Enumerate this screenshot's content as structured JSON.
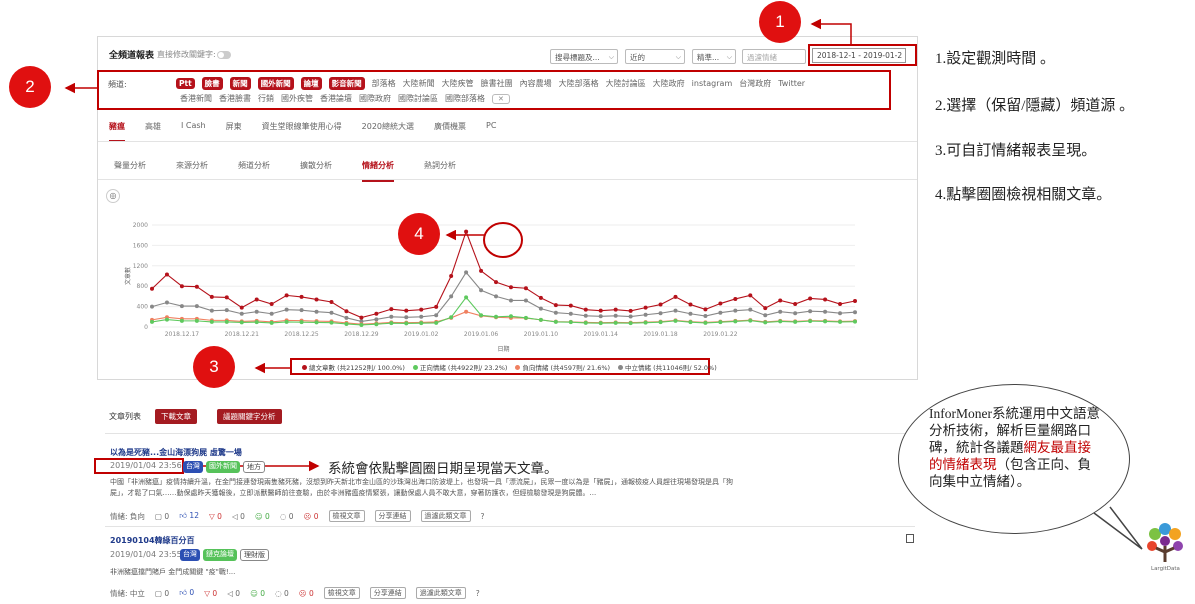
{
  "report": {
    "title": "全頻道報表",
    "sub": "直接修改關鍵字:",
    "selects": [
      "搜尋標題及...",
      "近的",
      "精準...",
      "過濾情緒"
    ],
    "date": "2018-12-1 - 2019-01-2",
    "channel_label": "頻道:",
    "channels_selected": [
      "Ptt",
      "臉書",
      "新聞",
      "國外新聞",
      "論壇",
      "影音新聞"
    ],
    "channels_row1": [
      "部落格",
      "大陸新聞",
      "大陸疾管",
      "臉書社團",
      "內容農場",
      "大陸部落格",
      "大陸討論區",
      "大陸政府",
      "instagram",
      "台灣政府",
      "Twitter"
    ],
    "channels_row2": [
      "香港新聞",
      "香港臉書",
      "行銷",
      "國外疾管",
      "香港論壇",
      "國際政府",
      "國際討論區",
      "國際部落格"
    ],
    "clear": "✕",
    "topic_tabs": [
      "豬瘟",
      "高雄",
      "I Cash",
      "屏東",
      "資生堂眼線筆使用心得",
      "2020總統大選",
      "廣價機票",
      "PC"
    ],
    "analysis_tabs": [
      "聲量分析",
      "來源分析",
      "頻道分析",
      "擴散分析",
      "情緒分析",
      "熱詞分析"
    ],
    "camera": "◎"
  },
  "chart_data": {
    "type": "line",
    "xlabel": "日期",
    "ylabel": "文章數",
    "ylim": [
      0,
      2000
    ],
    "yticks": [
      "0",
      "400",
      "800",
      "1200",
      "1600",
      "2000"
    ],
    "xticks": [
      "2018.12.17",
      "2018.12.21",
      "2018.12.25",
      "2018.12.29",
      "2019.01.02",
      "2019.01.06",
      "2019.01.10",
      "2019.01.14",
      "2019.01.18",
      "2019.01.22"
    ],
    "series": [
      {
        "name": "總文章數 (共21252則/ 100.0%)",
        "color": "#b5121b",
        "values": [
          750,
          1030,
          800,
          790,
          590,
          580,
          380,
          540,
          450,
          620,
          590,
          540,
          490,
          310,
          185,
          260,
          350,
          320,
          340,
          395,
          1000,
          1870,
          1100,
          880,
          780,
          760,
          570,
          430,
          420,
          340,
          320,
          340,
          315,
          380,
          440,
          590,
          440,
          345,
          460,
          550,
          620,
          370,
          520,
          450,
          560,
          540,
          450,
          510
        ]
      },
      {
        "name": "正向情緒 (共4922則/ 23.2%)",
        "color": "#5ec95e",
        "values": [
          100,
          145,
          120,
          120,
          100,
          100,
          90,
          95,
          80,
          100,
          95,
          90,
          85,
          60,
          40,
          55,
          75,
          70,
          75,
          80,
          190,
          580,
          230,
          200,
          210,
          180,
          140,
          100,
          95,
          80,
          75,
          80,
          75,
          85,
          95,
          120,
          95,
          80,
          95,
          110,
          125,
          90,
          110,
          100,
          115,
          110,
          100,
          105
        ]
      },
      {
        "name": "負向情緒 (共4597則/ 21.6%)",
        "color": "#f08060",
        "values": [
          140,
          190,
          160,
          160,
          130,
          130,
          110,
          120,
          100,
          130,
          125,
          115,
          110,
          80,
          55,
          70,
          90,
          85,
          90,
          100,
          180,
          300,
          220,
          190,
          180,
          175,
          140,
          105,
          100,
          90,
          85,
          90,
          85,
          95,
          105,
          130,
          105,
          90,
          105,
          120,
          135,
          100,
          120,
          110,
          125,
          120,
          110,
          115
        ]
      },
      {
        "name": "中立情緒 (共11046則/ 52.0%)",
        "color": "#888888",
        "values": [
          400,
          480,
          410,
          410,
          320,
          330,
          260,
          300,
          260,
          340,
          330,
          300,
          280,
          180,
          110,
          150,
          200,
          190,
          200,
          230,
          600,
          1070,
          720,
          600,
          520,
          520,
          360,
          280,
          260,
          220,
          210,
          220,
          205,
          240,
          270,
          320,
          260,
          215,
          280,
          320,
          340,
          230,
          300,
          270,
          310,
          300,
          270,
          290
        ]
      }
    ]
  },
  "articles": {
    "list_label": "文章列表",
    "download_btn": "下載文章",
    "topic_btn": "議題關鍵字分析",
    "items": [
      {
        "title": "以為是死豬...金山海漂狗屍 虛驚一場",
        "date": "2019/01/04 23:56",
        "tags": [
          "台灣",
          "國外新聞",
          "地方"
        ],
        "body1": "中國「非洲豬瘟」疫情持續升溫，在金門接連發現兩隻豬死豬，沒想到昨天新北市金山區的沙珠灣出海口防波堤上，也發現一具「漂流屍」，民眾一度以為是「豬屍」，通報檢疫人員趕往現場發現是具「狗",
        "body2": "屍」，才鬆了口氣……動保處昨天獲報後，立即派獸醫師前往查驗，由於非洲豬瘟疫情緊張，讓動保處人員不敢大意，穿著防護衣，但經檢驗發現是狗屍體。...",
        "stats": {
          "emotion": "情緒: 負向",
          "reply": "0",
          "like": "12",
          "dislike": "0",
          "share": "0",
          "pos": "0",
          "neu": "0",
          "neg": "0"
        },
        "buttons": [
          "檢視文章",
          "分享連結",
          "過濾此類文章"
        ]
      },
      {
        "title": "20190104韓綠百分百",
        "date": "2019/01/04 23:55",
        "tags": [
          "台灣",
          "鏈克論壇",
          "理財版"
        ],
        "body1": "非洲豬瘟擋門賭戶 金門成關鍵 \"疫\"戰!...",
        "stats": {
          "emotion": "情緒: 中立",
          "reply": "0",
          "like": "0",
          "dislike": "0",
          "share": "0",
          "pos": "0",
          "neu": "0",
          "neg": "0"
        },
        "buttons": [
          "檢視文章",
          "分享連結",
          "過濾此類文章"
        ]
      }
    ]
  },
  "annotations": {
    "n1": "1",
    "n2": "2",
    "n3": "3",
    "n4": "4",
    "note1": "1.設定觀測時間 。",
    "note2": "2.選擇（保留/隱藏）頻道源 。",
    "note3": "3.可自訂情緒報表呈現。",
    "note4": "4.點擊圈圈檢視相關文章。",
    "date_note": "系統會依點擊圓圈日期呈現當天文章。",
    "bubble_a": "InforMoner系統運用中文語意分析技術，解析巨量網路口碑，統計各議題",
    "bubble_b": "網友最直接的情緒表現",
    "bubble_c": "（包含正向、負向集中立情緒）。",
    "logo_text": "LargitData"
  }
}
